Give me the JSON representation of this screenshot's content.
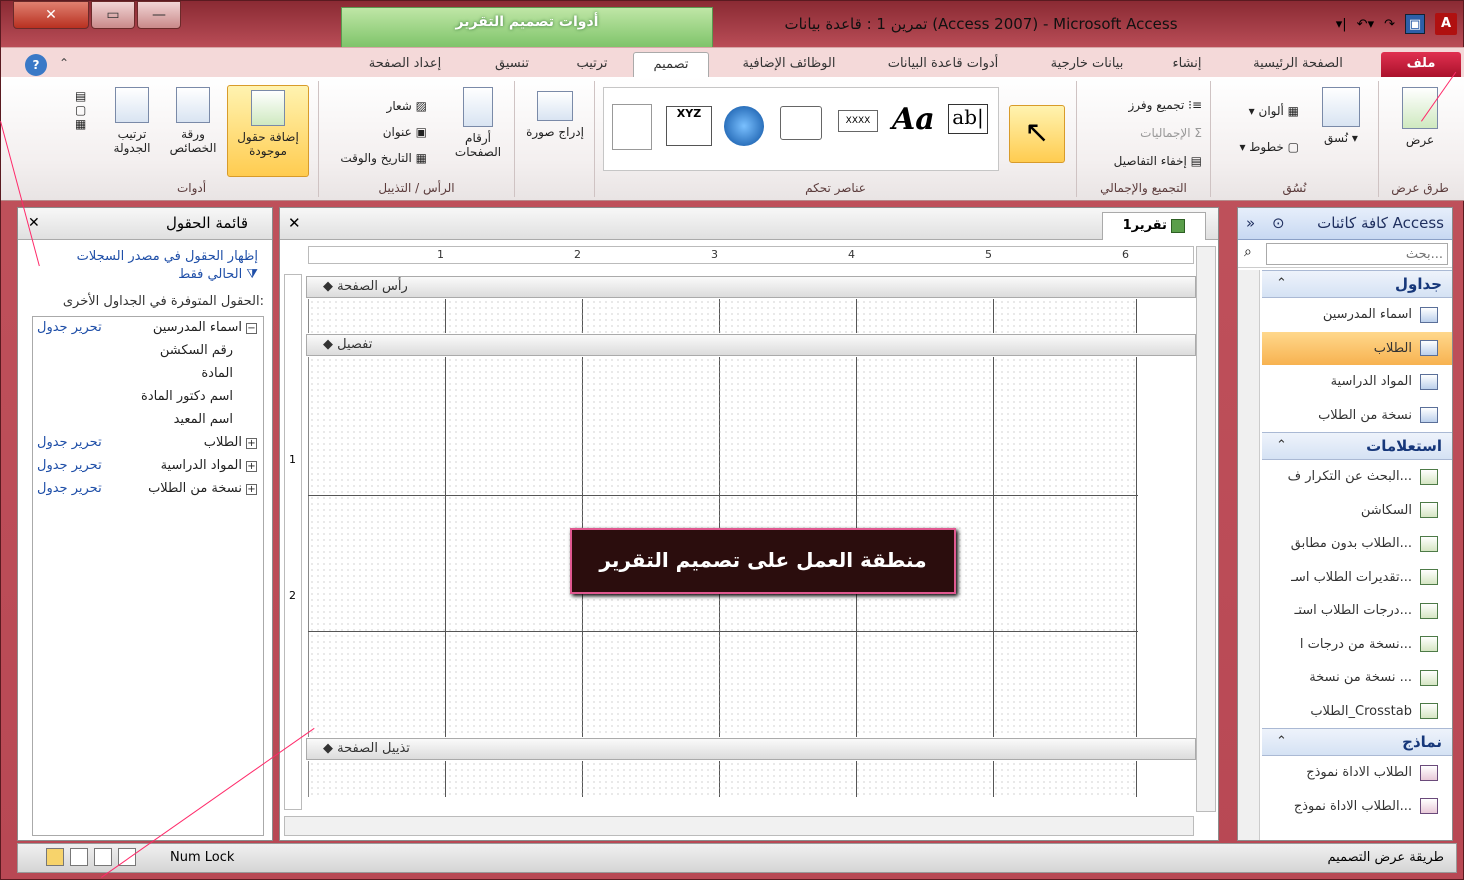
{
  "titlebar": {
    "app_title": "تمرين 1 : قاعدة بيانات (Access 2007) - Microsoft Access",
    "context_tools": "أدوات تصميم التقرير",
    "close": "✕",
    "restore": "▭",
    "minimize": "—"
  },
  "tabs": {
    "file": "ملف",
    "home": "الصفحة الرئيسية",
    "create": "إنشاء",
    "external": "بيانات خارجية",
    "dbtools": "أدوات قاعدة البيانات",
    "addins": "الوظائف الإضافية",
    "design": "تصميم",
    "arrange": "ترتيب",
    "format": "تنسيق",
    "pagesetup": "إعداد الصفحة"
  },
  "ribbon": {
    "views": {
      "label": "طرق عرض",
      "view": "عرض"
    },
    "themes": {
      "label": "نُسُق",
      "themes": "نُسق",
      "colors": "ألوان",
      "fonts": "خطوط"
    },
    "grouping": {
      "label": "التجميع والإجمالي",
      "group": "تجميع وفرز",
      "totals": "الإجماليات",
      "hide": "إخفاء التفاصيل"
    },
    "controls": {
      "label": "عناصر تحكم",
      "textbox": "ab|",
      "label_ctl": "Aa",
      "button": "XXXX",
      "chart": "XYZ"
    },
    "insertimage": {
      "label": "إدراج صورة"
    },
    "headerfooter": {
      "label": "الرأس / التذييل",
      "pagenums": "أرقام الصفحات",
      "logo": "شعار",
      "title": "عنوان",
      "datetime": "التاريخ والوقت"
    },
    "tools": {
      "label": "أدوات",
      "addfields": "إضافة حقول موجودة",
      "propsheet": "ورقة الخصائص",
      "taborder": "ترتيب الجدولة"
    }
  },
  "nav": {
    "title": "كافة كائنات Access",
    "search_placeholder": "بحث...",
    "tables_label": "جداول",
    "tables": [
      "اسماء المدرسين",
      "الطلاب",
      "المواد الدراسية",
      "نسخة من الطلاب"
    ],
    "queries_label": "استعلامات",
    "queries": [
      "البحث عن التكرار ف...",
      "السكاشن",
      "الطلاب بدون مطابق...",
      "تقديرات الطلاب اسـ...",
      "درجات الطلاب استـ...",
      "نسخة من درجات ا...",
      "نسخة من نسخة ...",
      "الطلاب_Crosstab"
    ],
    "forms_label": "نماذج",
    "forms": [
      "الطلاب الاداة نموذج",
      "الطلاب الاداة نموذج..."
    ]
  },
  "doc": {
    "tab": "تقرير1",
    "page_header": "رأس الصفحة",
    "detail": "تفصيل",
    "page_footer": "تذييل الصفحة",
    "callout": "منطقة العمل على تصميم التقرير",
    "ruler": [
      "1",
      "2",
      "3",
      "4",
      "5",
      "6"
    ],
    "vruler": [
      "1",
      "2"
    ]
  },
  "fieldlist": {
    "title": "قائمة الحقول",
    "show_link": "إظهار الحقول في مصدر السجلات الحالي فقط",
    "available": "الحقول المتوفرة في الجداول الأخرى:",
    "rows": [
      {
        "label": "اسماء المدرسين",
        "edit": "تحرير جدول",
        "expand": "−"
      },
      {
        "label": "رقم السكشن"
      },
      {
        "label": "المادة"
      },
      {
        "label": "اسم دكتور المادة"
      },
      {
        "label": "اسم المعيد"
      },
      {
        "label": "الطلاب",
        "edit": "تحرير جدول",
        "expand": "+"
      },
      {
        "label": "المواد الدراسية",
        "edit": "تحرير جدول",
        "expand": "+"
      },
      {
        "label": "نسخة من الطلاب",
        "edit": "تحرير جدول",
        "expand": "+"
      }
    ]
  },
  "status": {
    "numlock": "Num Lock",
    "mode": "طريقة عرض التصميم"
  }
}
